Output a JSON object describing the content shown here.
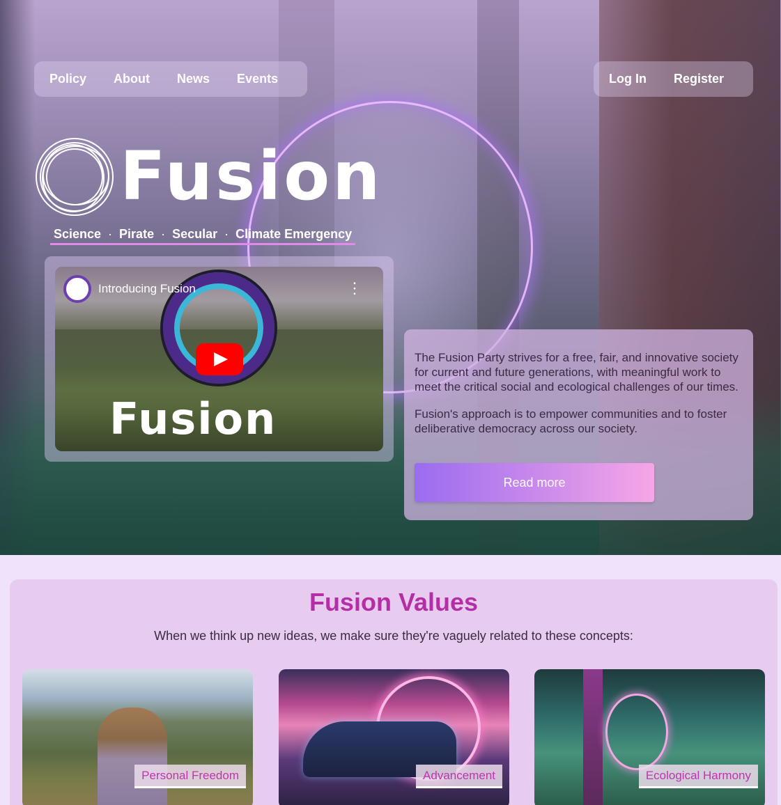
{
  "nav": {
    "left": [
      "Policy",
      "About",
      "News",
      "Events"
    ],
    "right": [
      "Log In",
      "Register"
    ]
  },
  "brand": {
    "name": "Fusion",
    "tagline": [
      "Science",
      "Pirate",
      "Secular",
      "Climate Emergency"
    ],
    "tagline_separator": "·"
  },
  "video": {
    "title": "Introducing Fusion",
    "overlay_word": "Fusion",
    "menu_icon": "more-vertical-icon",
    "play_icon": "youtube-play-icon"
  },
  "intro": {
    "paragraph_1": "The Fusion Party strives for a free, fair, and innovative society for current and future generations, with meaningful work to meet the critical social and ecological challenges of our times.",
    "paragraph_2": "Fusion's approach is to empower communities and to foster deliberative democracy across our society.",
    "cta": "Read more"
  },
  "values": {
    "title": "Fusion Values",
    "subtitle": "When we think up new ideas, we make sure they're vaguely related to these concepts:",
    "cards": [
      {
        "label": "Personal Freedom"
      },
      {
        "label": "Advancement"
      },
      {
        "label": "Ecological Harmony"
      }
    ]
  },
  "colors": {
    "accent": "#b42fa6",
    "button_start": "#9a6cf0",
    "button_end": "#f6a6e6",
    "page_bg": "#f1e2fb"
  }
}
